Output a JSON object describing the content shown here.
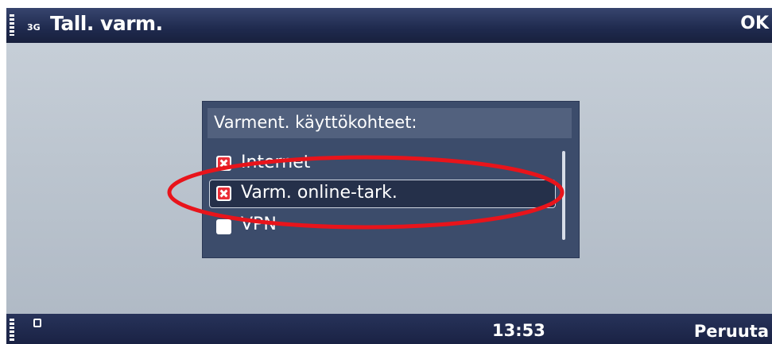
{
  "header": {
    "network_type": "3G",
    "title": "Tall. varm.",
    "ok_label": "OK"
  },
  "dialog": {
    "title": "Varment. käyttökohteet:",
    "items": [
      {
        "label": "Internet",
        "checked": true,
        "selected": false
      },
      {
        "label": "Varm. online-tark.",
        "checked": true,
        "selected": true
      },
      {
        "label": "VPN",
        "checked": false,
        "selected": false
      }
    ]
  },
  "footer": {
    "time": "13:53",
    "cancel_label": "Peruuta"
  },
  "icons": [
    "signal-strength-icon",
    "battery-icon",
    "lock-icon",
    "checkbox-checked-icon",
    "checkbox-unchecked-icon"
  ],
  "colors": {
    "bar_bg": "#1f2a4e",
    "dialog_bg": "#3c4c6b",
    "checkbox_x": "#ea2d36",
    "annotation_ellipse": "#e8141b"
  }
}
